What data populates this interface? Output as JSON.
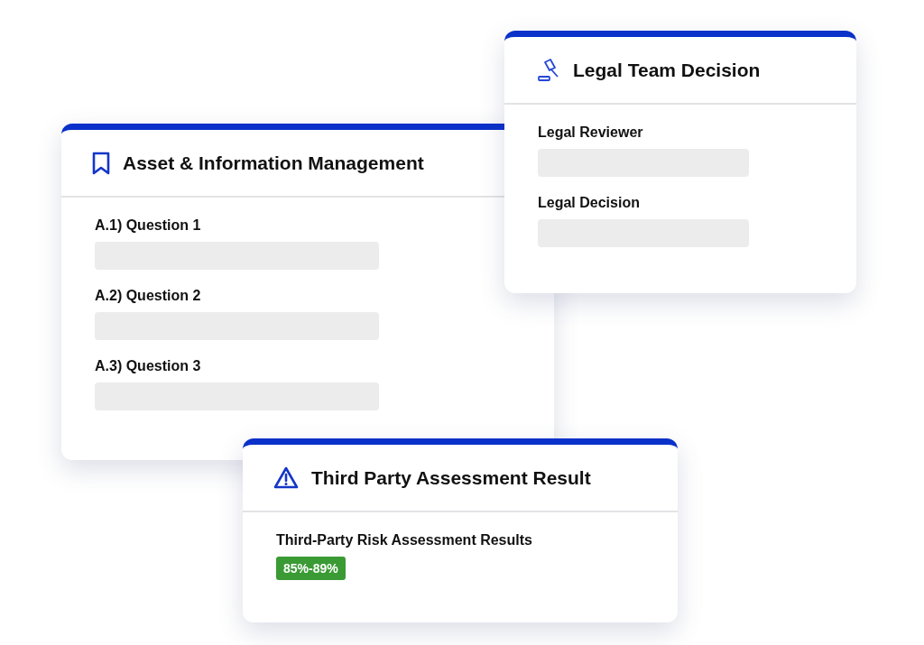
{
  "cards": [
    {
      "title": "Asset & Information Management",
      "items": [
        {
          "kind": "input",
          "label": "A.1) Question 1"
        },
        {
          "kind": "input",
          "label": "A.2) Question 2"
        },
        {
          "kind": "input",
          "label": "A.3) Question 3"
        }
      ]
    },
    {
      "title": "Legal Team Decision",
      "items": [
        {
          "kind": "input",
          "label": "Legal Reviewer"
        },
        {
          "kind": "input",
          "label": "Legal Decision"
        }
      ]
    },
    {
      "title": "Third Party Assessment Result",
      "items": [
        {
          "kind": "badge",
          "label": "Third-Party Risk Assessment Results",
          "value": "85%-89%",
          "color": "#3a9a34"
        }
      ]
    }
  ]
}
